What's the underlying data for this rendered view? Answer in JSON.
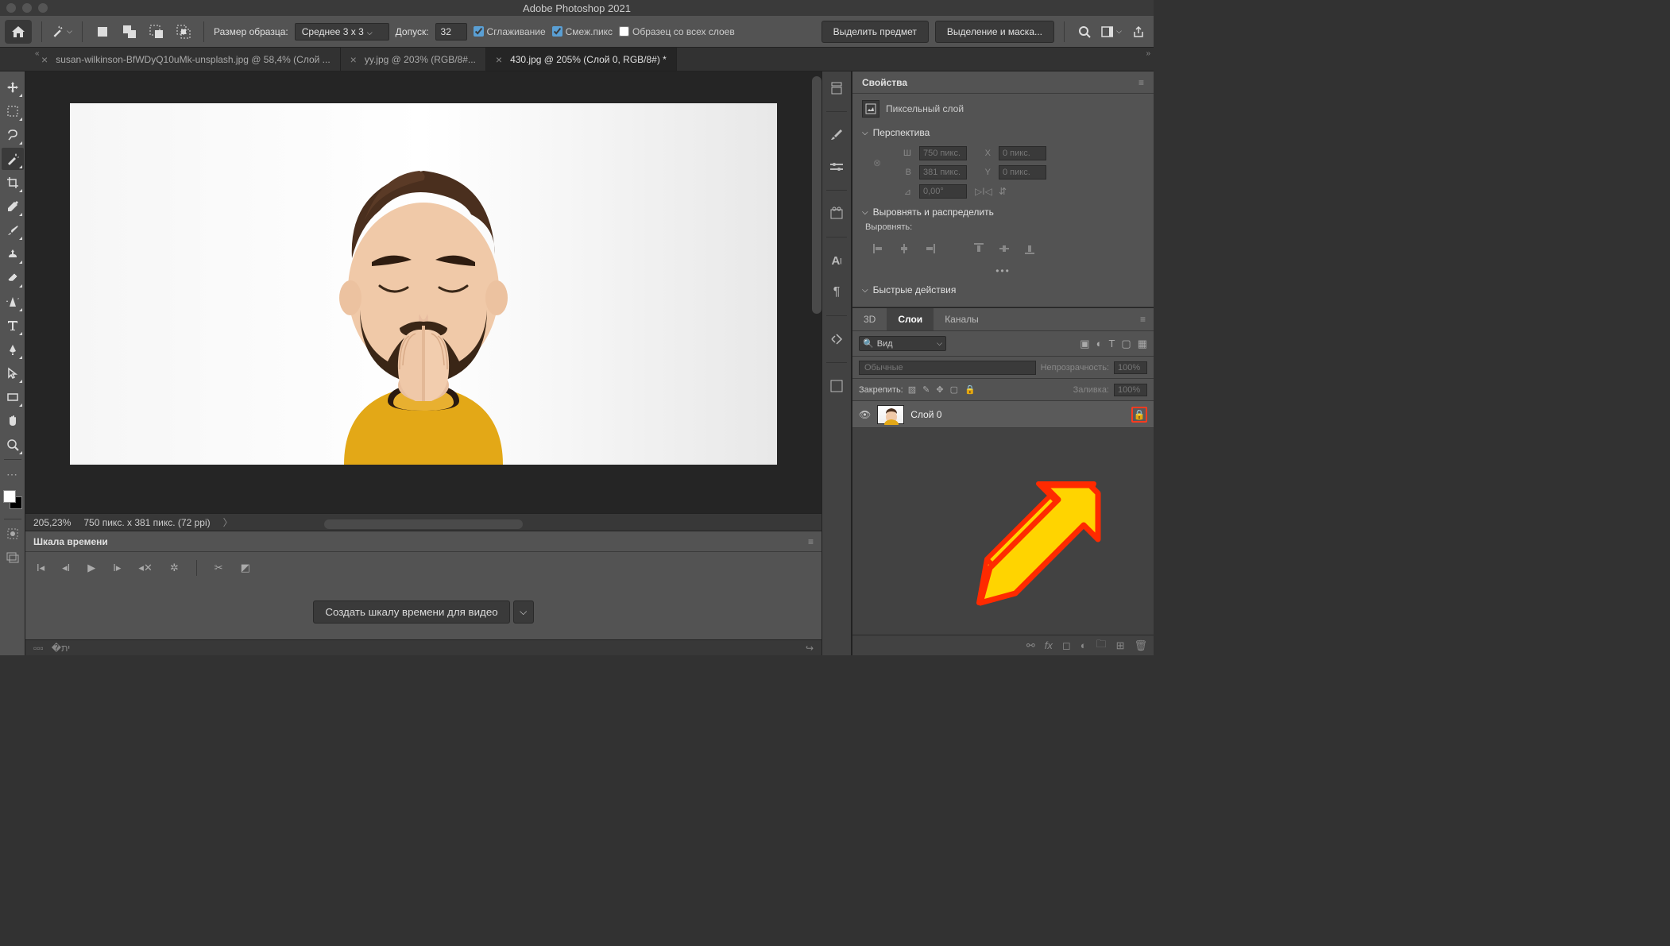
{
  "title": "Adobe Photoshop 2021",
  "optionsBar": {
    "sampleSizeLabel": "Размер образца:",
    "sampleSizeValue": "Среднее 3 x 3",
    "toleranceLabel": "Допуск:",
    "toleranceValue": "32",
    "antiAlias": "Сглаживание",
    "contiguous": "Смеж.пикс",
    "sampleAll": "Образец со всех слоев",
    "selectSubject": "Выделить предмет",
    "selectAndMask": "Выделение и маска..."
  },
  "tabs": [
    {
      "label": "susan-wilkinson-BfWDyQ10uMk-unsplash.jpg @ 58,4% (Слой ...",
      "active": false
    },
    {
      "label": "yy.jpg @ 203% (RGB/8#...",
      "active": false
    },
    {
      "label": "430.jpg @ 205% (Слой 0, RGB/8#) *",
      "active": true
    }
  ],
  "status": {
    "zoom": "205,23%",
    "docInfo": "750 пикс. x 381 пикс. (72 ppi)"
  },
  "timeline": {
    "title": "Шкала времени",
    "createBtn": "Создать шкалу времени для видео"
  },
  "properties": {
    "title": "Свойства",
    "layerType": "Пиксельный слой",
    "transformHeader": "Перспектива",
    "w": "750 пикс.",
    "h": "381 пикс.",
    "x": "0 пикс.",
    "y": "0 пикс.",
    "angle": "0,00°",
    "wLabel": "Ш",
    "hLabel": "В",
    "xLabel": "X",
    "yLabel": "Y",
    "alignHeader": "Выровнять и распределить",
    "alignLabel": "Выровнять:",
    "quickActions": "Быстрые действия"
  },
  "layersPanel": {
    "tabs": {
      "t3d": "3D",
      "layers": "Слои",
      "channels": "Каналы"
    },
    "filterKind": "Вид",
    "blendMode": "Обычные",
    "opacityLabel": "Непрозрачность:",
    "opacityValue": "100%",
    "lockLabel": "Закрепить:",
    "fillLabel": "Заливка:",
    "fillValue": "100%",
    "layer0": "Слой 0"
  }
}
